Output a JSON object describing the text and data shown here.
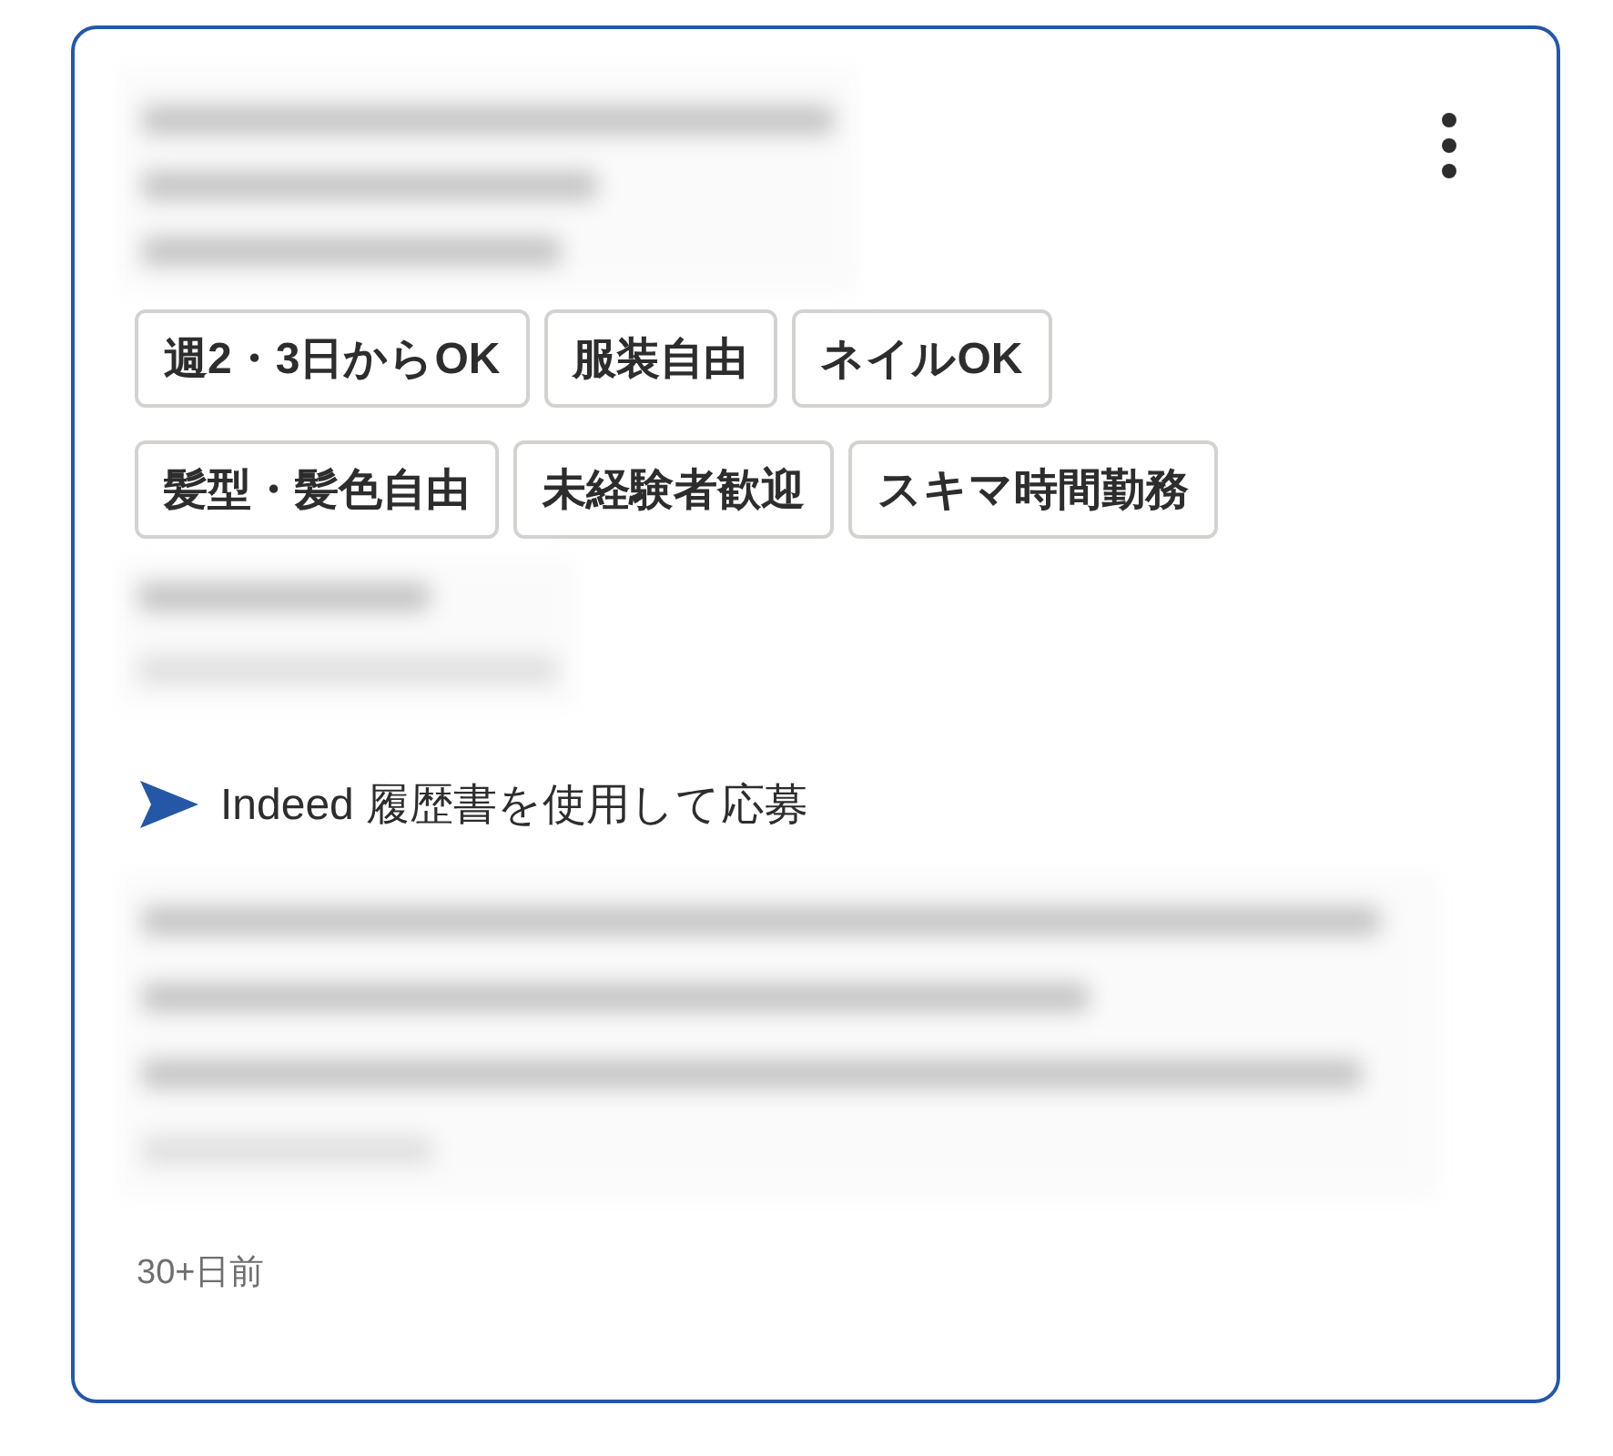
{
  "tag_rows": [
    [
      "週2・3日からOK",
      "服装自由",
      "ネイルOK"
    ],
    [
      "髪型・髪色自由",
      "未経験者歓迎",
      "スキマ時間勤務"
    ]
  ],
  "apply": {
    "text": "Indeed 履歴書を使用して応募"
  },
  "posted": "30+日前"
}
